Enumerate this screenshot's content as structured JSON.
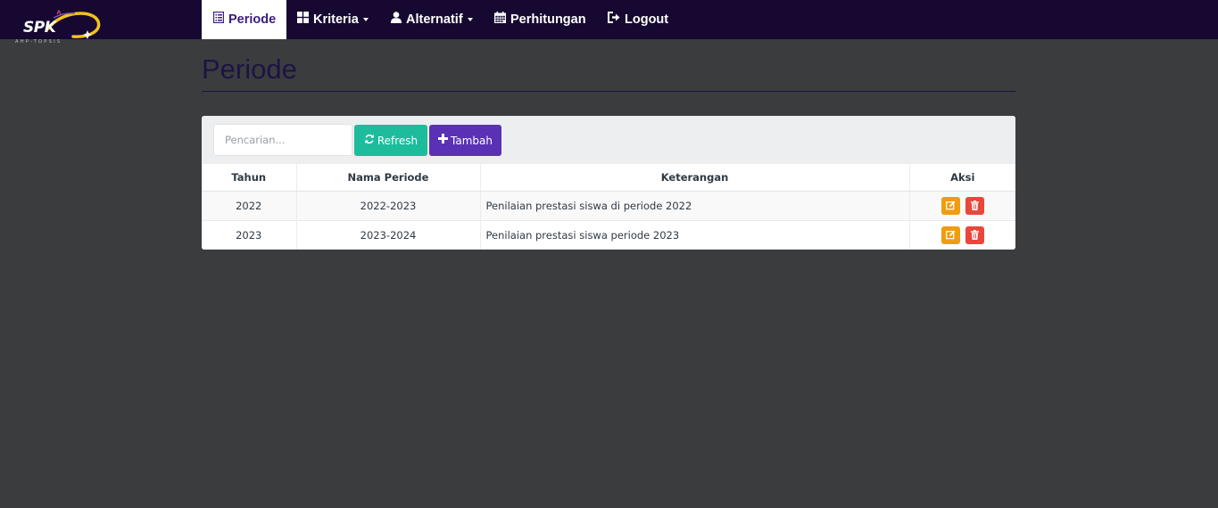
{
  "brand": {
    "logo_text": "SPK",
    "logo_sub": "AHP-TOPSIS"
  },
  "nav": {
    "items": [
      {
        "label": "Periode",
        "icon": "list-alt-icon",
        "active": true
      },
      {
        "label": "Kriteria",
        "icon": "th-large-icon",
        "dropdown": true
      },
      {
        "label": "Alternatif",
        "icon": "user-icon",
        "dropdown": true
      },
      {
        "label": "Perhitungan",
        "icon": "calendar-icon"
      },
      {
        "label": "Logout",
        "icon": "log-out-icon"
      }
    ]
  },
  "page": {
    "title": "Periode"
  },
  "toolbar": {
    "search_placeholder": "Pencarian...",
    "search_value": "",
    "refresh_label": "Refresh",
    "add_label": "Tambah"
  },
  "table": {
    "columns": [
      "Tahun",
      "Nama Periode",
      "Keterangan",
      "Aksi"
    ],
    "rows": [
      {
        "tahun": "2022",
        "nama": "2022-2023",
        "keterangan": "Penilaian prestasi siswa di periode 2022"
      },
      {
        "tahun": "2023",
        "nama": "2023-2024",
        "keterangan": "Penilaian prestasi siswa periode 2023"
      }
    ]
  },
  "colors": {
    "navbar": "#160830",
    "accent": "#5a31b5",
    "refresh": "#1cbc9c",
    "edit": "#f09c11",
    "delete": "#e8473c",
    "background": "#3b3c3e"
  }
}
